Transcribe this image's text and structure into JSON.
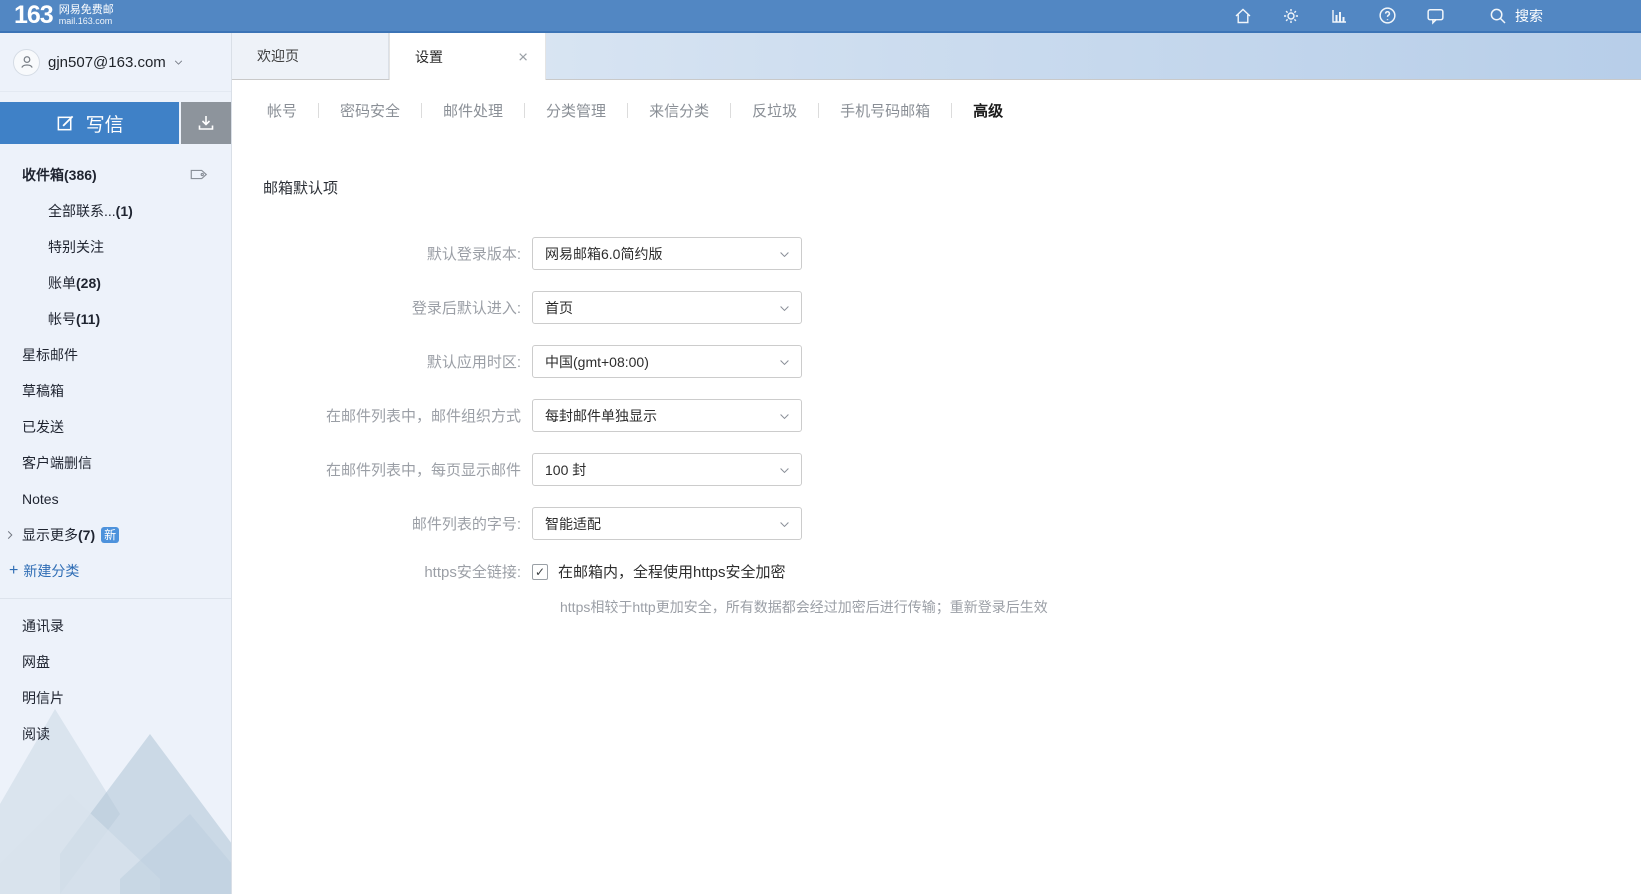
{
  "topbar": {
    "logo_number": "163",
    "logo_name": "网易免费邮",
    "logo_domain": "mail.163.com",
    "search_label": "搜索"
  },
  "account": {
    "email": "gjn507@163.com"
  },
  "compose": {
    "label": "写信"
  },
  "sidebar": {
    "inbox": {
      "label": "收件箱",
      "count": "(386)"
    },
    "contacts_sub": [
      {
        "label": "全部联系...",
        "count": "(1)"
      },
      {
        "label": "特别关注",
        "count": ""
      },
      {
        "label": "账单",
        "count": "(28)"
      },
      {
        "label": "帐号",
        "count": "(11)"
      }
    ],
    "folders": [
      "星标邮件",
      "草稿箱",
      "已发送",
      "客户端删信",
      "Notes"
    ],
    "show_more": {
      "label": "显示更多",
      "count": "(7)",
      "badge": "新"
    },
    "new_category": "新建分类",
    "bottom_items": [
      "通讯录",
      "网盘",
      "明信片",
      "阅读"
    ]
  },
  "tabs": {
    "welcome": "欢迎页",
    "settings": "设置",
    "close_glyph": "×"
  },
  "settings_nav": {
    "items": [
      "帐号",
      "密码安全",
      "邮件处理",
      "分类管理",
      "来信分类",
      "反垃圾",
      "手机号码邮箱",
      "高级"
    ],
    "active_index": 7
  },
  "content": {
    "section_title": "邮箱默认项",
    "rows": [
      {
        "label": "默认登录版本:",
        "value": "网易邮箱6.0简约版"
      },
      {
        "label": "登录后默认进入:",
        "value": "首页"
      },
      {
        "label": "默认应用时区:",
        "value": "中国(gmt+08:00)"
      },
      {
        "label": "在邮件列表中，邮件组织方式",
        "value": "每封邮件单独显示"
      },
      {
        "label": "在邮件列表中，每页显示邮件",
        "value": "100 封"
      },
      {
        "label": "邮件列表的字号:",
        "value": "智能适配"
      }
    ],
    "https_row": {
      "label": "https安全链接:",
      "checked": true,
      "checkbox_label": "在邮箱内，全程使用https安全加密",
      "help": "https相较于http更加安全，所有数据都会经过加密后进行传输；重新登录后生效"
    }
  },
  "colors": {
    "topbar_blue": "#5287c3",
    "compose_blue": "#3f81c7",
    "badge_blue": "#4d92dc",
    "link_blue": "#2f6db5"
  }
}
